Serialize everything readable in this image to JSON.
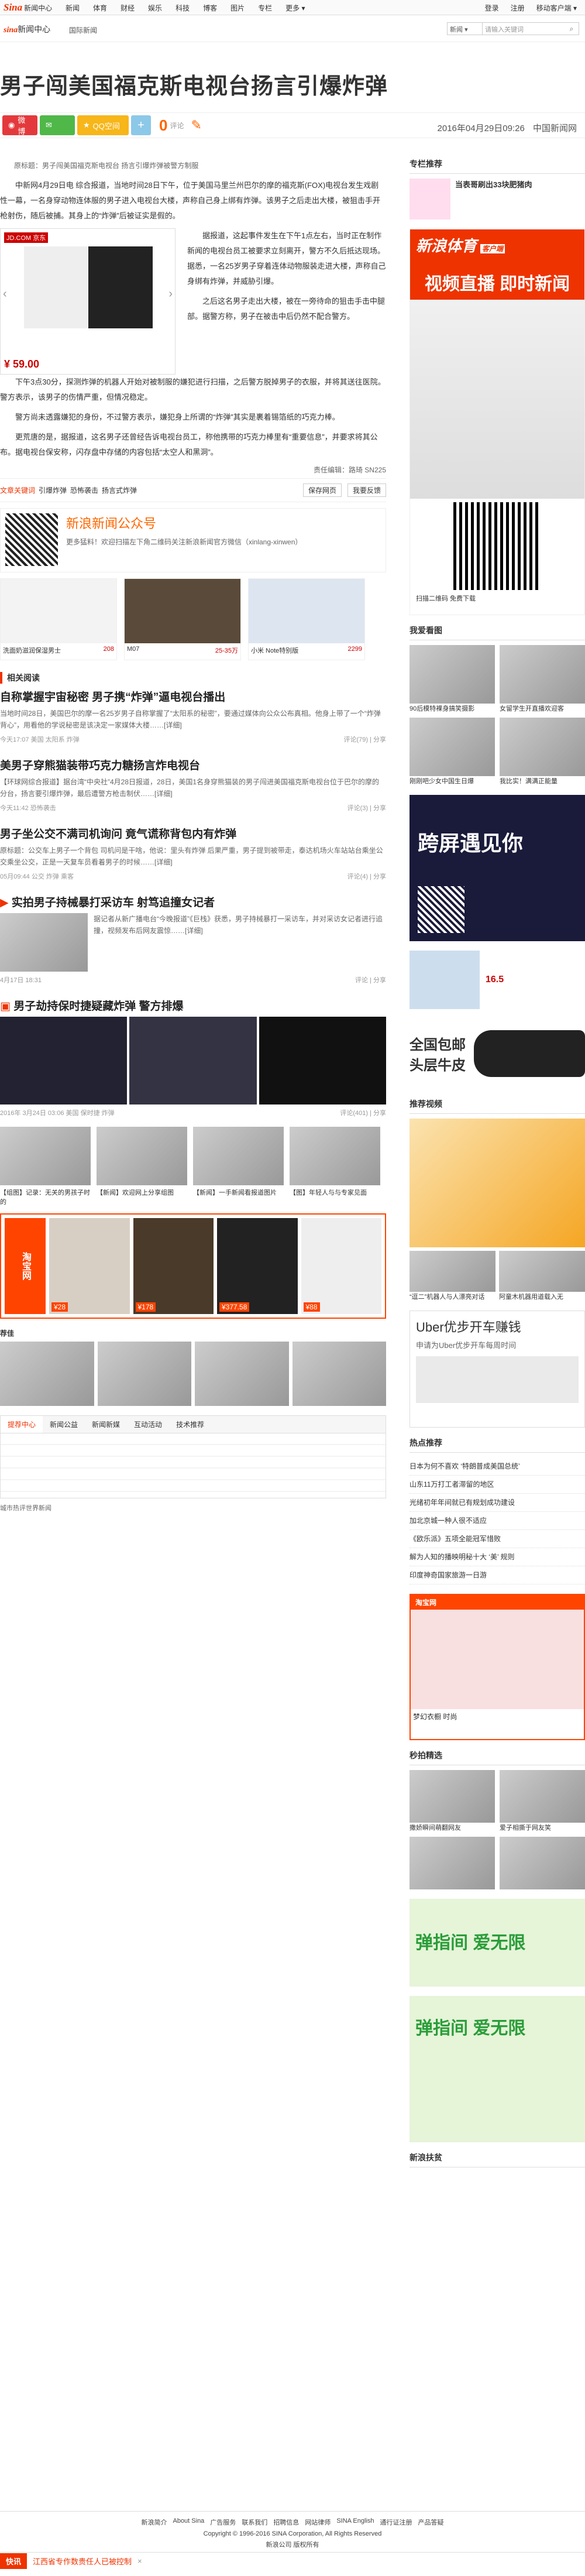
{
  "topbar": {
    "logo_sina": "Sina",
    "logo_news": "新闻中心",
    "nav": [
      "新闻",
      "体育",
      "财经",
      "娱乐",
      "科技",
      "博客",
      "图片",
      "专栏",
      "更多"
    ],
    "login": "登录",
    "register": "注册",
    "mobile": "移动客户端"
  },
  "header": {
    "logo_sina": "sina",
    "logo_news": "新闻中心",
    "breadcrumb": "国际新闻",
    "search_select": "新闻",
    "search_placeholder": "请输入关键词"
  },
  "title": "男子闯美国福克斯电视台扬言引爆炸弹",
  "share": {
    "weibo": "微博",
    "wechat": "",
    "qzone": "QQ空间",
    "plus": "+",
    "comment_count": "0",
    "comment_label": "评论"
  },
  "meta": {
    "datetime": "2016年04月29日09:26",
    "source": "中国新闻网"
  },
  "article": {
    "lead": "原标题：男子闯美国福克斯电视台 扬言引爆炸弹被警方制服",
    "paragraphs": [
      "中新网4月29日电 综合报道，当地时间28日下午，位于美国马里兰州巴尔的摩的福克斯(FOX)电视台发生戏剧性一幕，一名身穿动物连体服的男子进入电视台大楼，声称自己身上绑有炸弹。该男子之后走出大楼，被狙击手开枪射伤，随后被捕。其身上的“炸弹”后被证实是假的。",
      "据报道，这起事件发生在下午1点左右，当时正在制作新闻的电视台员工被要求立刻离开，警方不久后抵达现场。据悉，一名25岁男子穿着连体动物服装走进大楼，声称自己身绑有炸弹，并威胁引爆。",
      "之后这名男子走出大楼，被在一旁待命的狙击手击中腿部。据警方称，男子在被击中后仍然不配合警方。",
      "下午3点30分，探测炸弹的机器人开始对被制服的嫌犯进行扫描，之后警方脱掉男子的衣服，并将其送往医院。警方表示，该男子的伤情严重，但情况稳定。",
      "警方尚未透露嫌犯的身份，不过警方表示，嫌犯身上所谓的“炸弹”其实是裹着锡箔纸的巧克力棒。",
      "更荒唐的是，据报道，这名男子还曾经告诉电视台员工，称他携带的巧克力棒里有“重要信息”，并要求将其公布。据电视台保安称，闪存盘中存储的内容包括“太空人和黑洞”。"
    ],
    "ad_price": "¥ 59.00",
    "ad_brand": "JD.COM 京东",
    "editor": "责任编辑：路琦 SN225"
  },
  "tags": {
    "label": "文章关键词",
    "items": [
      "引爆炸弹",
      "恐怖袭击",
      "扬言式炸弹"
    ],
    "save": "保存网页",
    "feedback": "我要反馈"
  },
  "wechat_box": {
    "title": "新浪新闻公众号",
    "desc": "更多猛料！欢迎扫描左下角二维码关注新浪新闻官方微信（xinlang-xinwen）"
  },
  "products": [
    {
      "name": "洗面奶滋润保湿男士",
      "price": "208"
    },
    {
      "name": "M07",
      "price": "25-35万"
    },
    {
      "name": "小米 Note特别版",
      "price": "2299"
    }
  ],
  "related_title": "相关阅读",
  "related": [
    {
      "title": "自称掌握宇宙秘密 男子携“炸弹”逼电视台播出",
      "desc": "当地时间28日，美国巴尔的摩一名25岁男子自称掌握了“太阳系的秘密”，要通过媒体向公众公布真相。他身上带了一个“炸弹背心”，用看他的学说秘密是该决定一家媒体大楼……[详细]",
      "time": "今天17:07",
      "tags": "美国 太阳系 炸弹",
      "stat": "评论(79) | 分享"
    },
    {
      "title": "美男子穿熊猫装带巧克力糖扬言炸电视台",
      "desc": "【环球网综合报道】据台湾“中央社”4月28日报道，28日，美国1名身穿熊猫装的男子闯进美国福克斯电视台位于巴尔的摩的分台，扬言要引爆炸弹，最后遭警方枪击制伏……[详细]",
      "time": "今天11:42",
      "tags": "恐怖袭击",
      "stat": "评论(3) | 分享"
    },
    {
      "title": "男子坐公交不满司机询问 竟气谎称背包内有炸弹",
      "desc": "原标题：公交车上男子一个背包 司机问是干啥，他说：里头有炸弹 后果严重，男子提到被带走，泰达机场火车站站台乘坐公交乘坐公交，正是一天复车员看着男子的时候……[详细]",
      "time": "05月09:44",
      "tags": "公交 炸弹 乘客",
      "stat": "评论(4) | 分享"
    },
    {
      "title": "实拍男子持械暴打采访车 射笃追撞女记者",
      "desc": "据记者从新广播电台“今晚报道”《巨栈》获悉，男子持械暴打一采访车，并对采访女记者进行追撞，视频发布后网友震惊……[详细]",
      "time": "4月17日 18:31",
      "tags": "",
      "stat": "评论 | 分享"
    }
  ],
  "photo_block": {
    "title": "男子劫持保时捷疑藏炸弹 警方排爆",
    "time": "2016年 3月24日 03:06",
    "tags": "美国 保时捷 炸弹",
    "stat": "评论(401) | 分享",
    "captions": [
      "【组图】记录：无关的男孩子时的",
      "【新闻】欢迎网上分享组图",
      "【新闻】一手新闻看报道图片",
      "【图】年轻人与与专家见面"
    ]
  },
  "taobao": {
    "label": "淘宝网",
    "prices": [
      "¥28",
      "¥178",
      "¥377.58",
      "¥88"
    ]
  },
  "tabs": {
    "recommend_label": "荐佳",
    "items": [
      "提荐中心",
      "新闻公益",
      "新闻新媒",
      "互动活动",
      "技术推荐"
    ]
  },
  "bottom_links": "城市热评世界新闻",
  "side": {
    "column_title": "专栏推荐",
    "column_item": "当表哥刷出33块肥猪肉",
    "sina_sports": "新浪体育",
    "sports_sub": "客户端",
    "video_live": "视频直播 即时新闻",
    "qr_tip": "扫描二维码 免费下载",
    "my_pics": "我爱看图",
    "pic_captions": [
      "90后模特裸身搞笑摄影",
      "女留学生开直播欢迎客",
      "刚刚吧少女中国生日爆",
      "我比实！满满正能量"
    ],
    "ad_text": "跨屏遇见你",
    "price": "16.5",
    "ad_shoe": "全国包邮 头层牛皮",
    "video_title": "推荐视频",
    "video_captions": [
      "“逗二”机器人与人漂亮对话",
      "阿童木机器用道载入无"
    ],
    "uber_title": "Uber优步开车赚钱",
    "uber_sub": "申请为Uber优步开车每周时间",
    "hot_title": "热点推荐",
    "hot_list": [
      "日本为何不喜欢 ‘特朗普成美国总统’",
      "山东11万打工者滞留的地区",
      "光绪初年年间就已有规划成功建设",
      "加北京城一种人很不适应",
      "《欧乐派》五项全能冠军惜败",
      "解为人知的播映明秘十大 ‘美’ 规则",
      "印度神奇国家旅游一日游"
    ],
    "taobao_label": "淘宝网",
    "taobao_sub": "梦幻衣橱 时尚",
    "second_title": "秒拍精选",
    "second_captions": [
      "撒娇瞬间萌翻网友",
      "爱子相撕于网友笑"
    ],
    "apps": [
      "弹指间 爱无限",
      "弹指间 爱无限"
    ],
    "sina_support": "新浪扶贫"
  },
  "footer": {
    "links": [
      "新浪简介",
      "About Sina",
      "广告服务",
      "联系我们",
      "招聘信息",
      "网站律师",
      "SINA English",
      "通行证注册",
      "产品答疑"
    ],
    "copyright": "Copyright © 1996-2016 SINA Corporation, All Rights Reserved",
    "company": "新浪公司 版权所有"
  },
  "flash": {
    "label": "快讯",
    "text": "江西省专作数贵任人已被控制",
    "close": "×"
  }
}
